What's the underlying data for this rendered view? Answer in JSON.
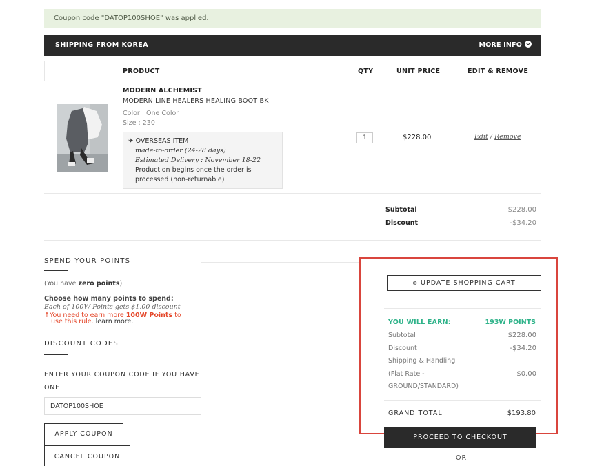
{
  "notice": "Coupon code \"DATOP100SHOE\" was applied.",
  "shipping": {
    "title": "SHIPPING FROM KOREA",
    "more_info": "MORE INFO"
  },
  "table": {
    "headers": {
      "product": "PRODUCT",
      "qty": "QTY",
      "unit_price": "UNIT PRICE",
      "edit_remove": "EDIT & REMOVE"
    }
  },
  "item": {
    "brand": "MODERN ALCHEMIST",
    "name": "MODERN LINE HEALERS HEALING BOOT BK",
    "color": "Color : One Color",
    "size": "Size : 230",
    "overseas": {
      "label": "OVERSEAS ITEM",
      "made_to_order": "made-to-order (24-28 days)",
      "estimated": "Estimated Delivery : November 18-22",
      "production_1": "Production begins once the order is",
      "production_2": "processed (non-returnable)"
    },
    "qty": "1",
    "unit_price": "$228.00",
    "edit": "Edit",
    "slash": "/",
    "remove": "Remove"
  },
  "summary": {
    "subtotal_label": "Subtotal",
    "subtotal_value": "$228.00",
    "discount_label": "Discount",
    "discount_value": "-$34.20"
  },
  "points": {
    "title": "SPEND YOUR POINTS",
    "have_prefix": "(You have ",
    "have_bold": "zero points",
    "have_suffix": ")",
    "choose": "Choose how many points to spend:",
    "each": "Each of 100W Points gets $1.00 discount",
    "earn_prefix": "You need to earn more ",
    "earn_bold": "100W Points",
    "earn_suffix": " to",
    "earn_line2": "use this rule.",
    "learn_more": " learn more."
  },
  "discount": {
    "title": "DISCOUNT CODES",
    "prompt": "ENTER YOUR COUPON CODE IF YOU HAVE ONE.",
    "code_value": "DATOP100SHOE",
    "apply": "APPLY COUPON",
    "cancel": "CANCEL COUPON"
  },
  "totals": {
    "update_cart": "UPDATE SHOPPING CART",
    "earn_label": "YOU WILL EARN:",
    "earn_value": "193W POINTS",
    "subtotal_label": "Subtotal",
    "subtotal_value": "$228.00",
    "discount_label": "Discount",
    "discount_value": "-$34.20",
    "shipping_label": "Shipping & Handling",
    "flat_rate_1": "(Flat Rate -",
    "flat_rate_2": "GROUND/STANDARD)",
    "shipping_value": "$0.00",
    "grand_label": "GRAND TOTAL",
    "grand_value": "$193.80",
    "checkout": "PROCEED TO CHECKOUT",
    "or": "OR"
  },
  "colors": {
    "accent_green": "#2fb38a",
    "warning_red": "#e4472a",
    "highlight_border": "#d9453d",
    "dark_bar": "#2a2a2a",
    "notice_bg": "#e8f1e0"
  },
  "icons": [
    "chevron-circle-down-icon",
    "plane-icon",
    "arrow-up-icon",
    "refresh-icon"
  ]
}
